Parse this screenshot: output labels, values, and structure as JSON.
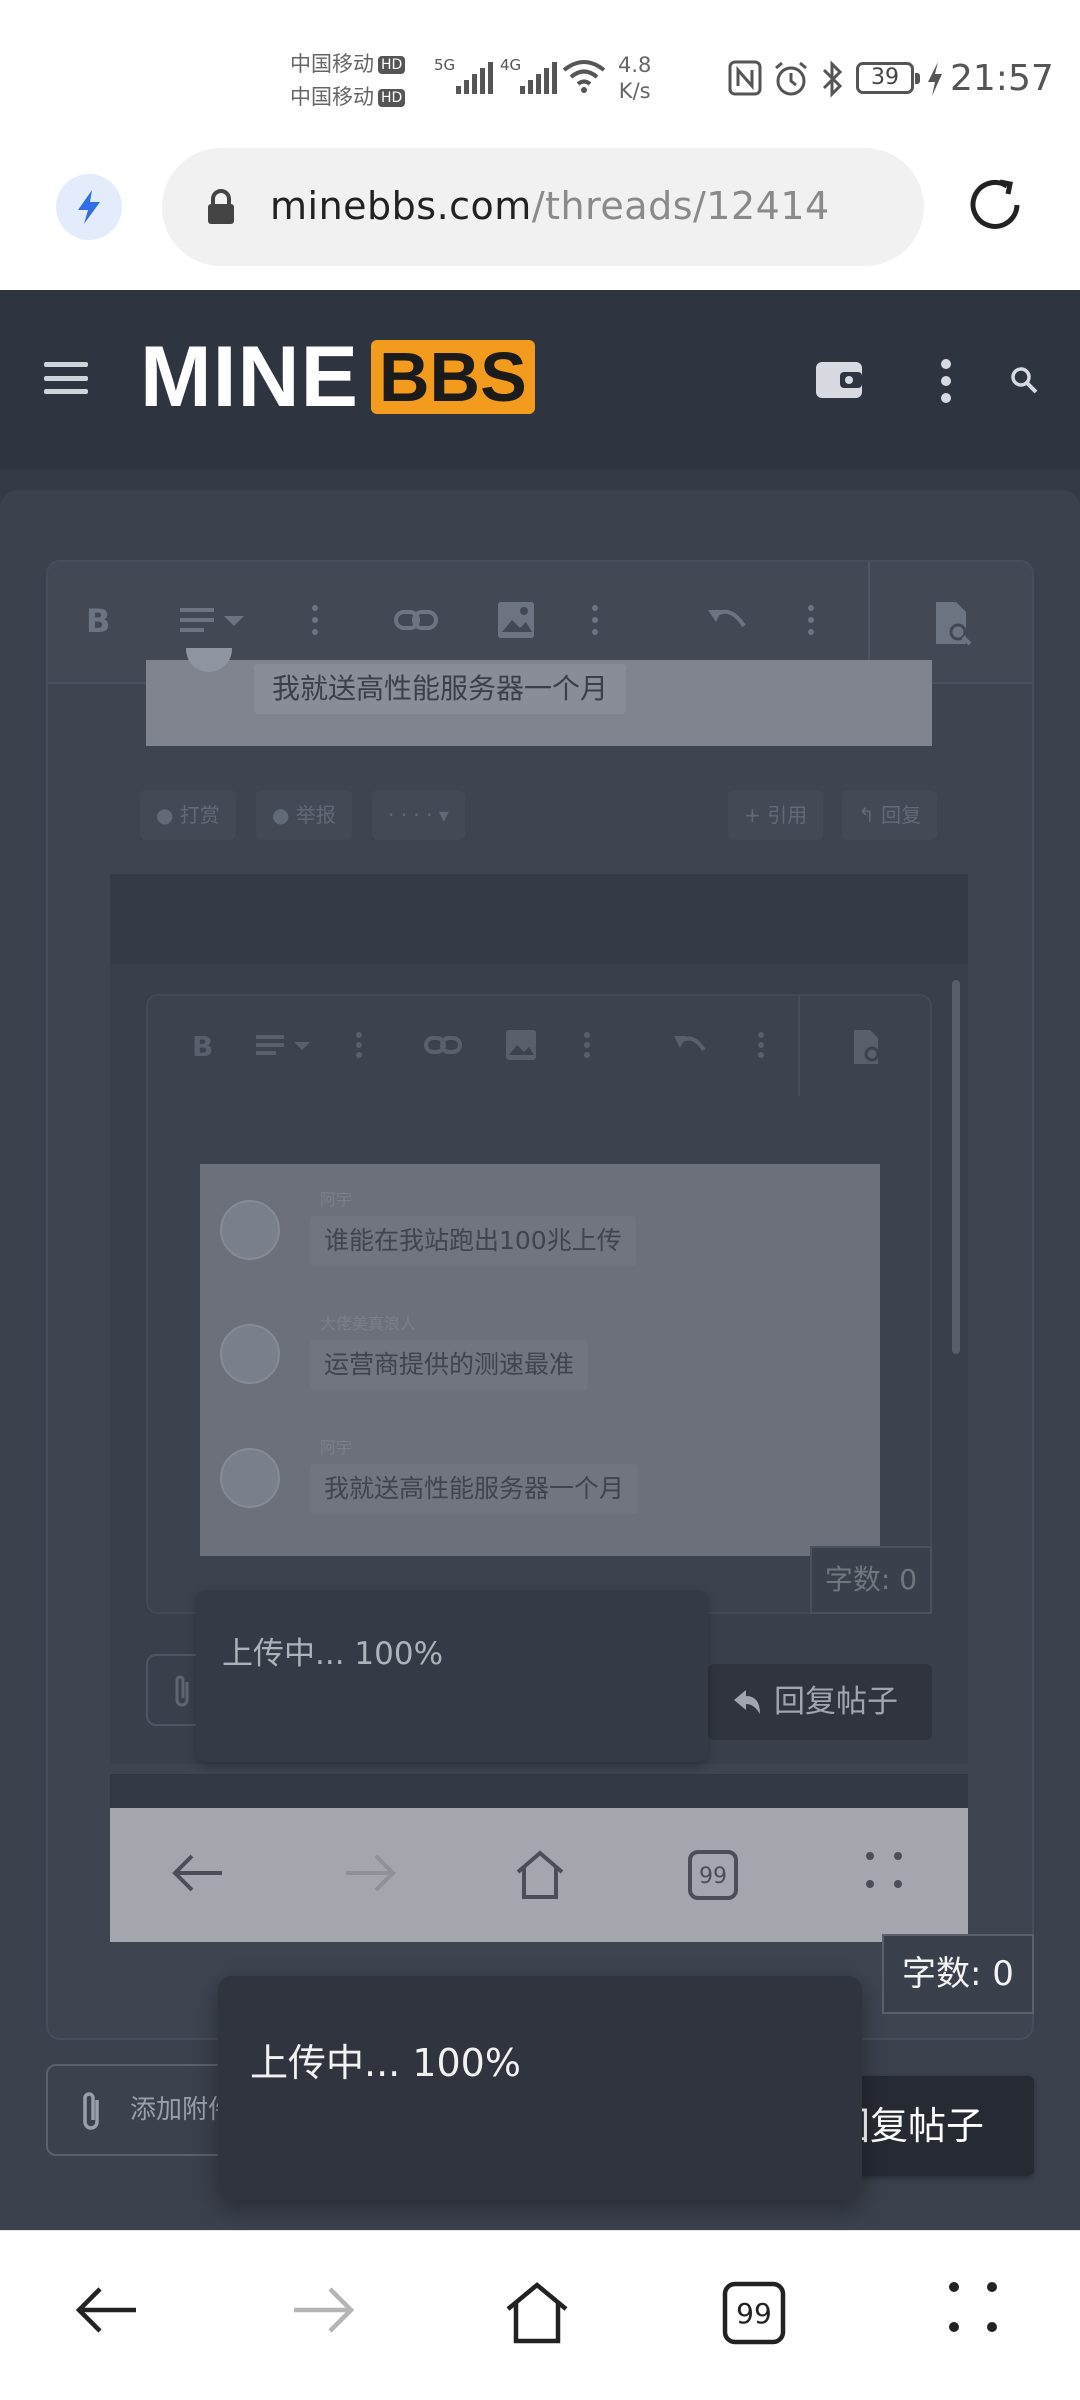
{
  "status_bar": {
    "carrier_1": "中国移动",
    "carrier_2": "中国移动",
    "hd_badge": "HD",
    "net_5g": "5G",
    "net_4g": "4G",
    "speed_value": "4.8",
    "speed_unit": "K/s",
    "battery": "39",
    "time": "21:57"
  },
  "browser": {
    "url_host": "minebbs.com",
    "url_path": "/threads/12414"
  },
  "site": {
    "logo_mine": "MINE",
    "logo_bbs": "BBS"
  },
  "ghost": {
    "quote_text": "我就送高性能服务器一个月",
    "actions": {
      "tip": "打赏",
      "report": "举报",
      "more": "· · · · ▾",
      "quote": "+ 引用",
      "reply": "回复"
    },
    "messages": [
      {
        "name": "阿宇",
        "text": "谁能在我站跑出100兆上传"
      },
      {
        "name": "大佬美真浪人",
        "text": "运营商提供的测速最准"
      },
      {
        "name": "阿宇",
        "text": "我就送高性能服务器一个月"
      }
    ],
    "char_count": "字数: 0",
    "toast": "上传中... 100%",
    "reply_label": "回复帖子"
  },
  "editor": {
    "char_count": "字数: 0",
    "attach_label": "添加附件",
    "reply_label": "回复帖子",
    "upload_toast": "上传中... 100%"
  },
  "colors": {
    "header_bg": "#2e3440",
    "brand_orange": "#f39b1c",
    "page_bg": "#343a46"
  }
}
